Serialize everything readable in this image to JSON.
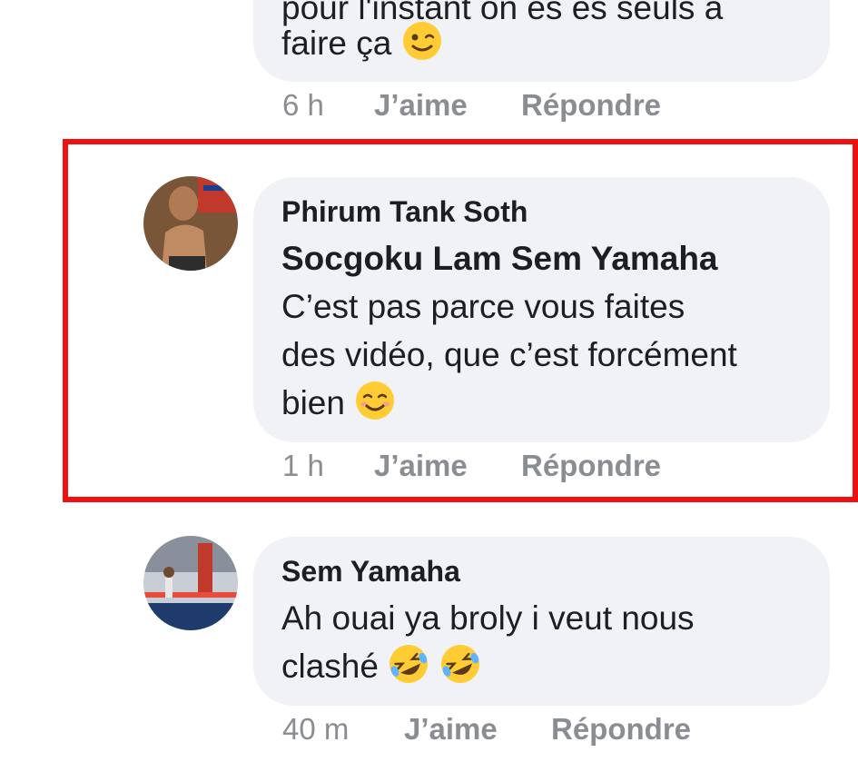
{
  "comments": [
    {
      "text_line1": "pour l'instant on es es seuls à",
      "text_line2": "faire ça",
      "emoji": "winking-face-emoji",
      "time": "6 h",
      "like": "J’aime",
      "reply": "Répondre"
    },
    {
      "author": "Phirum Tank Soth",
      "mention": "Socgoku Lam Sem Yamaha",
      "text_line1": "C’est pas parce vous faites",
      "text_line2": "des vidéo, que c’est forcément",
      "text_line3": "bien",
      "emoji": "smiling-face-emoji",
      "time": "1 h",
      "like": "J’aime",
      "reply": "Répondre"
    },
    {
      "author": "Sem Yamaha",
      "text_line1": "Ah ouai ya broly i veut nous",
      "text_line2": "clashé",
      "emoji": "rolling-on-floor-laughing-emoji",
      "time": "40 m",
      "like": "J’aime",
      "reply": "Répondre"
    }
  ],
  "colors": {
    "bubble": "#f0f2f5",
    "highlight": "#ee1111",
    "meta": "#8a8d91",
    "text": "#1c1e21"
  }
}
